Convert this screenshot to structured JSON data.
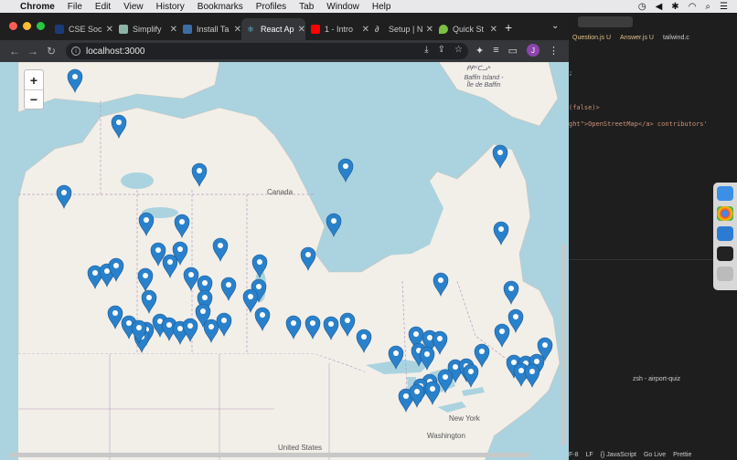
{
  "menubar": {
    "app": "Chrome",
    "items": [
      "File",
      "Edit",
      "View",
      "History",
      "Bookmarks",
      "Profiles",
      "Tab",
      "Window",
      "Help"
    ]
  },
  "tabs": [
    {
      "title": "CSE Soc",
      "color": "#1a3b7a"
    },
    {
      "title": "Simplify",
      "color": "#8ab4a8"
    },
    {
      "title": "Install Ta",
      "color": "#3b6ea5"
    },
    {
      "title": "React Ap",
      "color": "#61dafb",
      "active": true
    },
    {
      "title": "1 - Intro",
      "color": "#ff0000"
    },
    {
      "title": "Setup | N",
      "color": "#1f1f1f"
    },
    {
      "title": "Quick St",
      "color": "#7bc043"
    }
  ],
  "address": {
    "url": "localhost:3000"
  },
  "profile": {
    "initial": "J"
  },
  "map": {
    "zoom_in": "+",
    "zoom_out": "−",
    "labels": {
      "canada": "Canada",
      "baffin": "Baffin Island - Île de Baffin",
      "baffin_top": "ᑭᑭᑦᑕᓗᒃ",
      "new_york": "New York",
      "washington": "Washington",
      "united_states": "United States"
    },
    "colors": {
      "water": "#aad3df",
      "land": "#f2efe9",
      "marker": "#2a81cb"
    }
  },
  "vscode": {
    "tabs": [
      "Question.js U",
      "Answer.js U",
      "tailwind.c"
    ],
    "code": [
      "(false)>",
      "ght\">OpenStreetMap</a> contributors'"
    ],
    "terminal": "zsh - airport-quiz",
    "status": [
      "F-8",
      "LF",
      "{} JavaScript",
      "Go Live",
      "Prettie"
    ]
  }
}
